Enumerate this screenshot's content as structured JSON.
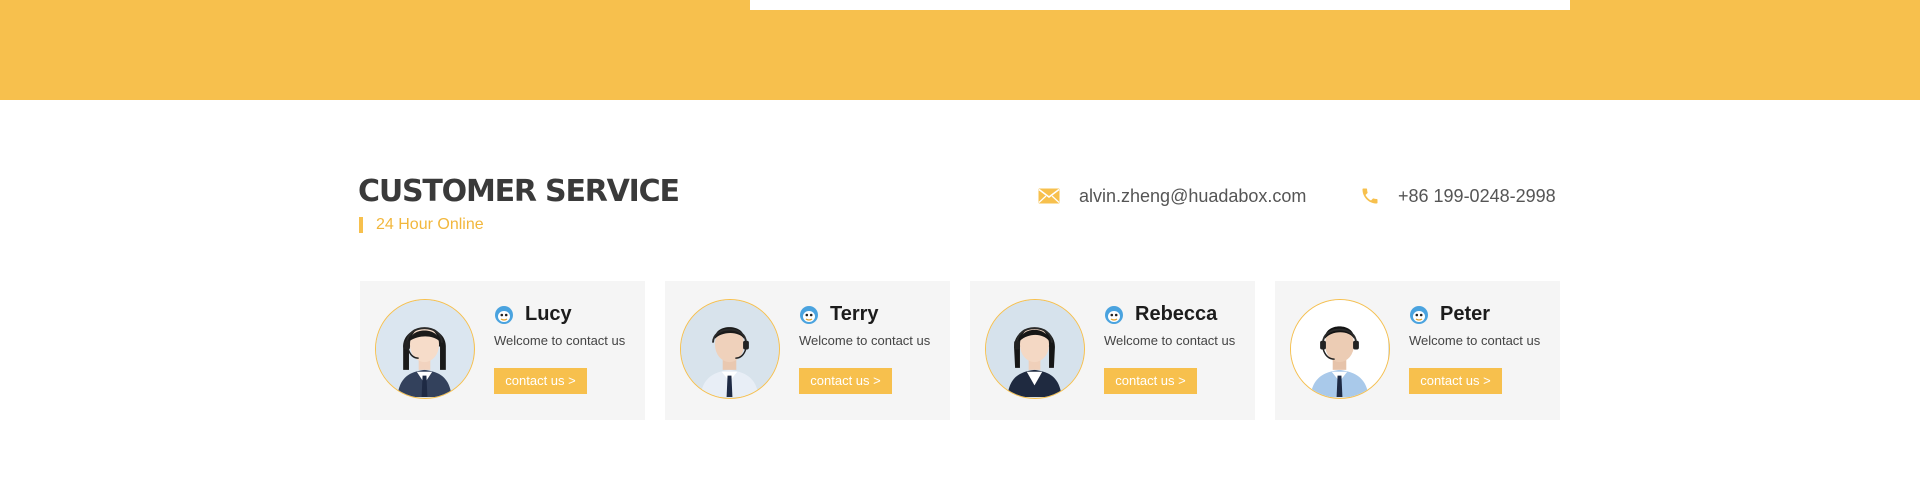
{
  "colors": {
    "accent": "#f7c04d",
    "subtitle": "#f2b73c",
    "card_background": "#f5f5f5",
    "title": "#3a3a3a",
    "qq_icon": "#4aa3df"
  },
  "section": {
    "title": "CUSTOMER SERVICE",
    "subtitle": "24 Hour Online"
  },
  "contact": {
    "email_icon": "envelope-icon",
    "email": "alvin.zheng@huadabox.com",
    "phone_icon": "phone-icon",
    "phone": "+86 199-0248-2998"
  },
  "agents": [
    {
      "name": "Lucy",
      "welcome": "Welcome to contact us",
      "button": "contact us >",
      "icon": "qq-icon",
      "gender": "female"
    },
    {
      "name": "Terry",
      "welcome": "Welcome to contact us",
      "button": "contact us >",
      "icon": "qq-icon",
      "gender": "male"
    },
    {
      "name": "Rebecca",
      "welcome": "Welcome to contact us",
      "button": "contact us >",
      "icon": "qq-icon",
      "gender": "female"
    },
    {
      "name": "Peter",
      "welcome": "Welcome to contact us",
      "button": "contact us >",
      "icon": "qq-icon",
      "gender": "male"
    }
  ]
}
